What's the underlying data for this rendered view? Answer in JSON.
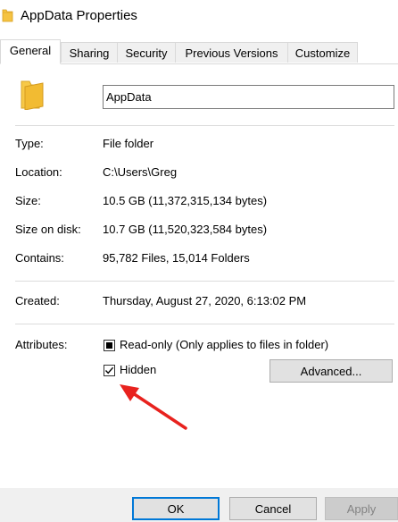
{
  "window": {
    "title": "AppData Properties"
  },
  "tabs": [
    {
      "label": "General"
    },
    {
      "label": "Sharing"
    },
    {
      "label": "Security"
    },
    {
      "label": "Previous Versions"
    },
    {
      "label": "Customize"
    }
  ],
  "name_field": {
    "value": "AppData"
  },
  "properties": {
    "type": {
      "label": "Type:",
      "value": "File folder"
    },
    "location": {
      "label": "Location:",
      "value": "C:\\Users\\Greg"
    },
    "size": {
      "label": "Size:",
      "value": "10.5 GB (11,372,315,134 bytes)"
    },
    "size_on_disk": {
      "label": "Size on disk:",
      "value": "10.7 GB (11,520,323,584 bytes)"
    },
    "contains": {
      "label": "Contains:",
      "value": "95,782 Files, 15,014 Folders"
    },
    "created": {
      "label": "Created:",
      "value": "Thursday, August 27, 2020, 6:13:02 PM"
    }
  },
  "attributes": {
    "label": "Attributes:",
    "readonly": {
      "label": "Read-only (Only applies to files in folder)",
      "state": "indeterminate"
    },
    "hidden": {
      "label": "Hidden",
      "checked": true
    },
    "advanced_label": "Advanced..."
  },
  "footer": {
    "ok_label": "OK",
    "cancel_label": "Cancel",
    "apply_label": "Apply"
  },
  "colors": {
    "folder": "#f5c342",
    "annotation_arrow": "#e8221e",
    "accent": "#0078d7"
  },
  "icons": {
    "title": "folder-icon",
    "large": "folder-icon",
    "annotation": "red-arrow"
  }
}
